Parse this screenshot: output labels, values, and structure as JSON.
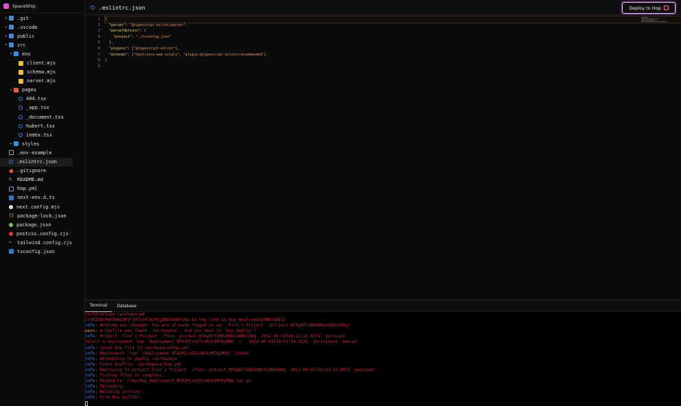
{
  "sidebar": {
    "title": "SpaceShip",
    "items": [
      {
        "label": ".git",
        "depth": 0,
        "kind": "folder",
        "chevron": "right",
        "icon": "folder-icon"
      },
      {
        "label": ".vscode",
        "depth": 0,
        "kind": "folder",
        "chevron": "right",
        "icon": "folder-icon"
      },
      {
        "label": "public",
        "depth": 0,
        "kind": "folder",
        "chevron": "right",
        "icon": "folder-icon"
      },
      {
        "label": "src",
        "depth": 0,
        "kind": "folder-open",
        "chevron": "down",
        "icon": "folder-open-icon"
      },
      {
        "label": "env",
        "depth": 1,
        "kind": "folder-open",
        "chevron": "down",
        "icon": "folder-open-icon"
      },
      {
        "label": "client.mjs",
        "depth": 2,
        "kind": "js",
        "icon": "javascript-file-icon"
      },
      {
        "label": "schema.mjs",
        "depth": 2,
        "kind": "js",
        "icon": "javascript-file-icon"
      },
      {
        "label": "server.mjs",
        "depth": 2,
        "kind": "js",
        "icon": "javascript-file-icon"
      },
      {
        "label": "pages",
        "depth": 1,
        "kind": "folder-red",
        "chevron": "down",
        "icon": "pages-folder-icon"
      },
      {
        "label": "404.tsx",
        "depth": 2,
        "kind": "ts",
        "icon": "react-ts-file-icon"
      },
      {
        "label": "_app.tsx",
        "depth": 2,
        "kind": "ts",
        "icon": "react-ts-file-icon"
      },
      {
        "label": "_document.tsx",
        "depth": 2,
        "kind": "ts",
        "icon": "react-ts-file-icon"
      },
      {
        "label": "hubert.tsx",
        "depth": 2,
        "kind": "ts",
        "icon": "react-ts-file-icon"
      },
      {
        "label": "index.tsx",
        "depth": 2,
        "kind": "ts",
        "icon": "react-ts-file-icon"
      },
      {
        "label": "styles",
        "depth": 1,
        "kind": "folder",
        "chevron": "right",
        "icon": "folder-icon"
      },
      {
        "label": ".env-example",
        "depth": 0,
        "kind": "env",
        "icon": "env-file-icon"
      },
      {
        "label": ".eslintrc.json",
        "depth": 0,
        "kind": "ts",
        "icon": "eslint-file-icon",
        "active": true
      },
      {
        "label": ".gitignore",
        "depth": 0,
        "kind": "git",
        "icon": "git-file-icon"
      },
      {
        "label": "README.md",
        "depth": 0,
        "kind": "md",
        "icon": "markdown-file-icon"
      },
      {
        "label": "hop.yml",
        "depth": 0,
        "kind": "yml",
        "icon": "yaml-file-icon"
      },
      {
        "label": "next-env.d.ts",
        "depth": 0,
        "kind": "tsfile",
        "icon": "typescript-file-icon"
      },
      {
        "label": "next.config.mjs",
        "depth": 0,
        "kind": "next",
        "icon": "nextjs-file-icon"
      },
      {
        "label": "package-lock.json",
        "depth": 0,
        "kind": "jsonb",
        "icon": "json-file-icon"
      },
      {
        "label": "package.json",
        "depth": 0,
        "kind": "pjson",
        "icon": "npm-package-icon"
      },
      {
        "label": "postcss.config.cjs",
        "depth": 0,
        "kind": "postcss",
        "icon": "postcss-file-icon"
      },
      {
        "label": "tailwind.config.cjs",
        "depth": 0,
        "kind": "tw",
        "icon": "tailwind-file-icon"
      },
      {
        "label": "tsconfig.json",
        "depth": 0,
        "kind": "tsfile",
        "icon": "typescript-config-icon"
      }
    ]
  },
  "editor": {
    "tab_label": ".eslintrc.json",
    "deploy_label": "Deploy to Hop",
    "lines": [
      [
        {
          "t": "{",
          "c": "b"
        }
      ],
      [
        {
          "t": "  ",
          "c": "b"
        },
        {
          "t": "\"parser\"",
          "c": "k"
        },
        {
          "t": ": ",
          "c": "b"
        },
        {
          "t": "\"@typescript-eslint/parser\"",
          "c": "s"
        },
        {
          "t": ",",
          "c": "b"
        }
      ],
      [
        {
          "t": "  ",
          "c": "b"
        },
        {
          "t": "\"parserOptions\"",
          "c": "k"
        },
        {
          "t": ": ",
          "c": "b"
        },
        {
          "t": "{",
          "c": "p"
        }
      ],
      [
        {
          "t": "    ",
          "c": "b"
        },
        {
          "t": "\"project\"",
          "c": "k"
        },
        {
          "t": ": ",
          "c": "b"
        },
        {
          "t": "\"./tsconfig.json\"",
          "c": "s"
        }
      ],
      [
        {
          "t": "  ",
          "c": "b"
        },
        {
          "t": "}",
          "c": "p"
        },
        {
          "t": ",",
          "c": "b"
        }
      ],
      [
        {
          "t": "  ",
          "c": "b"
        },
        {
          "t": "\"plugins\"",
          "c": "k"
        },
        {
          "t": ": ",
          "c": "b"
        },
        {
          "t": "[",
          "c": "p"
        },
        {
          "t": "\"@typescript-eslint\"",
          "c": "s"
        },
        {
          "t": "]",
          "c": "p"
        },
        {
          "t": ",",
          "c": "b"
        }
      ],
      [
        {
          "t": "  ",
          "c": "b"
        },
        {
          "t": "\"extends\"",
          "c": "k"
        },
        {
          "t": ": ",
          "c": "b"
        },
        {
          "t": "[",
          "c": "p"
        },
        {
          "t": "\"next/core-web-vitals\"",
          "c": "s"
        },
        {
          "t": ", ",
          "c": "b"
        },
        {
          "t": "\"plugin:@typescript-eslint/recommended\"",
          "c": "s"
        },
        {
          "t": "]",
          "c": "p"
        }
      ],
      [
        {
          "t": "}",
          "c": "b"
        }
      ],
      []
    ]
  },
  "panel": {
    "tabs": [
      "Terminal",
      "Database"
    ],
    "active_tab": "Terminal",
    "terminal_lines": [
      [
        {
          "t": "root@railway:/workspace# ",
          "c": "prompt"
        }
      ],
      [
        {
          "t": "ZjU0ZGUxMmM2NWU3MjFiMTk3MTAxMjg3NDYwNDY1Nw && hop link && hop deploy$OUyNHMxZWI5Z",
          "c": ""
        }
      ],
      [
        {
          "t": "info: ",
          "c": "lvl-info"
        },
        {
          "t": "Nothing was changed. You are already logged in as: `Finn's Project` (project_NTAyNTY3NDU0Nzk1ODk5ODg)",
          "c": ""
        }
      ],
      [
        {
          "t": "warn: ",
          "c": "lvl-warn"
        },
        {
          "t": "A hopfile was found `/workspace`, did you mean to `hop deploy`?",
          "c": ""
        }
      ],
      [
        {
          "t": "info: ",
          "c": "lvl-info"
        },
        {
          "t": "Project: Finn's Project  /finn  project_NTAyNTY3NDU0Nzk1ODk5ODg  2022-09-02T16:22:21.897Z  personal",
          "c": ""
        }
      ],
      [
        {
          "t": "Select a deployment: hop  deployment_NTA2MjcxOTcwMzk3MTAyMDk  1   2022-09-03T16:54:24.383Z  persistent  manual",
          "c": ""
        }
      ],
      [
        {
          "t": "info: ",
          "c": "lvl-info"
        },
        {
          "t": "Saved hop file to /workspace/hop.yml",
          "c": ""
        }
      ],
      [
        {
          "t": "info: ",
          "c": "lvl-info"
        },
        {
          "t": "Deployment `hop` (deployment_NTA2MjcxOTcwMzk3MTAyMDk) linked",
          "c": ""
        }
      ],
      [
        {
          "t": "info: ",
          "c": "lvl-info"
        },
        {
          "t": "Attempting to deploy /workspace",
          "c": ""
        }
      ],
      [
        {
          "t": "info: ",
          "c": "lvl-info"
        },
        {
          "t": "Found hopfile: /workspace/hop.yml",
          "c": ""
        }
      ],
      [
        {
          "t": "info: ",
          "c": "lvl-info"
        },
        {
          "t": "Deploying to project Finn's Project  /finn  project_NTAyNTY3NDU0Nzk1ODk5ODg  2022-09-02T16:22:21.897Z  personal",
          "c": ""
        }
      ],
      [
        {
          "t": "info: ",
          "c": "lvl-info"
        },
        {
          "t": "Finding files to compress...",
          "c": ""
        }
      ],
      [
        {
          "t": "info: ",
          "c": "lvl-info"
        },
        {
          "t": "Packed to: /tmp/hop_deployment_NTA2MjcxOTcwMzk3MTAyMDk.tar.gz",
          "c": ""
        }
      ],
      [
        {
          "t": "info: ",
          "c": "lvl-info"
        },
        {
          "t": "Uploading...",
          "c": ""
        }
      ],
      [
        {
          "t": "info: ",
          "c": "lvl-info"
        },
        {
          "t": "Deleting archive...",
          "c": ""
        }
      ],
      [
        {
          "t": "info: ",
          "c": "lvl-info"
        },
        {
          "t": "From Hop builder:",
          "c": ""
        }
      ]
    ]
  }
}
